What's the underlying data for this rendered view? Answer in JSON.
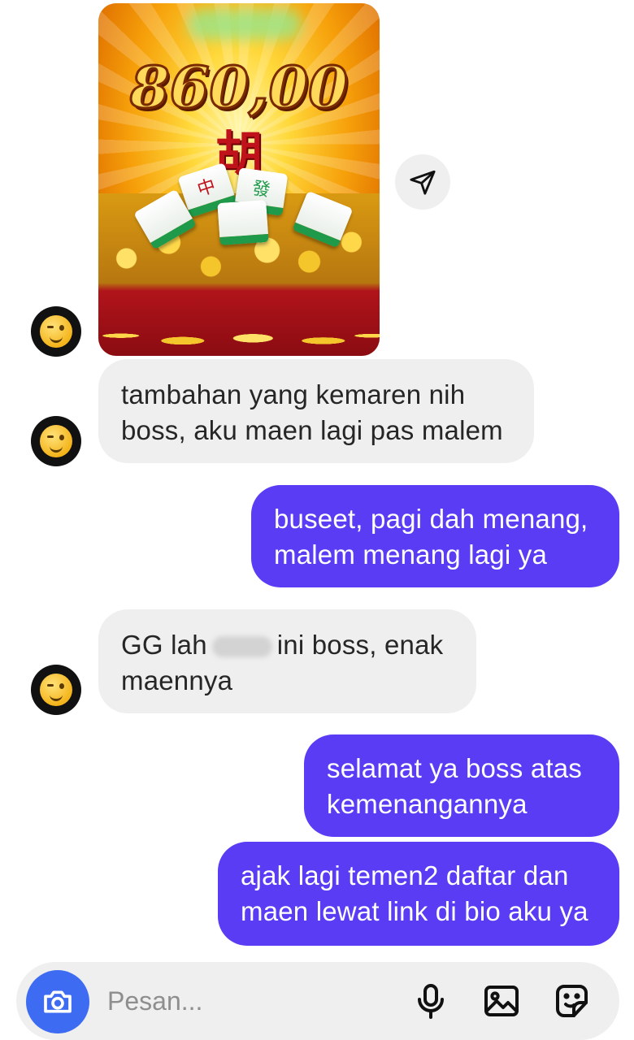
{
  "shared_post": {
    "amount_text": "860,00",
    "hu_char": "胡",
    "tile_chars": [
      "中",
      "發",
      "",
      ""
    ]
  },
  "messages": [
    {
      "direction": "in",
      "lines": [
        "tambahan yang kemaren nih",
        "boss, aku maen lagi pas malem"
      ]
    },
    {
      "direction": "out",
      "lines": [
        "buseet, pagi dah menang,",
        "malem menang lagi ya"
      ]
    },
    {
      "direction": "in",
      "line1_before": "GG lah",
      "line1_after": "ini boss, enak",
      "line2": "maennya"
    },
    {
      "direction": "out",
      "lines": [
        "selamat ya boss atas",
        "kemenangannya"
      ]
    },
    {
      "direction": "out",
      "lines": [
        "ajak lagi temen2 daftar dan",
        "maen lewat link di bio aku ya"
      ]
    }
  ],
  "composer": {
    "placeholder": "Pesan..."
  },
  "icons": {
    "share": "paper-plane-icon",
    "camera": "camera-icon",
    "mic": "microphone-icon",
    "gallery": "gallery-icon",
    "sticker": "sticker-icon",
    "avatar": "winking-emoji-icon"
  },
  "colors": {
    "outgoing_bubble": "#5b3cf5",
    "incoming_bubble": "#efefef",
    "camera_button": "#3d6cf3"
  }
}
